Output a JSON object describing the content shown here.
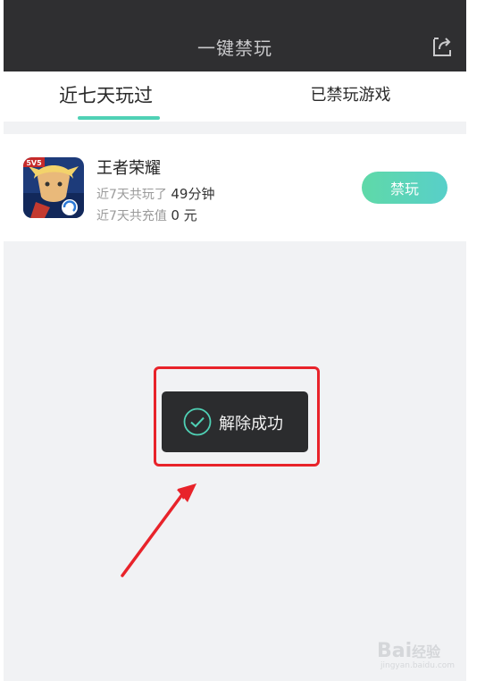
{
  "header": {
    "title": "一键禁玩",
    "share_icon": "share-export-icon"
  },
  "tabs": [
    {
      "label": "近七天玩过",
      "active": true
    },
    {
      "label": "已禁玩游戏",
      "active": false
    }
  ],
  "accent_color": "#4fd1b5",
  "game": {
    "name": "王者荣耀",
    "play_prefix": "近7天共玩了",
    "play_value": "49分钟",
    "charge_prefix": "近7天共充值",
    "charge_value": "0 元",
    "ban_label": "禁玩",
    "icon_badge": "5V5"
  },
  "toast": {
    "text": "解除成功",
    "icon": "check-circle-icon"
  },
  "watermark": {
    "text": "Bai",
    "suffix": "经验",
    "sub": "jingyan.baidu.com"
  }
}
